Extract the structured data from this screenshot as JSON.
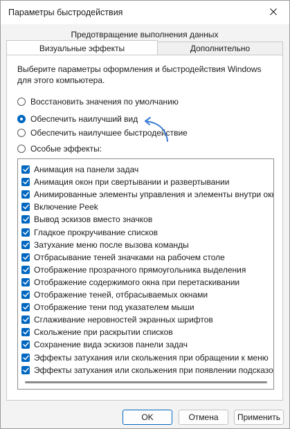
{
  "window": {
    "title": "Параметры быстродействия"
  },
  "tabs": {
    "top_row": "Предотвращение выполнения данных",
    "active": "Визуальные эффекты",
    "inactive": "Дополнительно"
  },
  "description": "Выберите параметры оформления и быстродействия Windows для этого компьютера.",
  "radios": [
    {
      "label": "Восстановить значения по умолчанию",
      "checked": false
    },
    {
      "label": "Обеспечить наилучший вид",
      "checked": true
    },
    {
      "label": "Обеспечить наилучшее быстродействие",
      "checked": false
    },
    {
      "label": "Особые эффекты:",
      "checked": false
    }
  ],
  "effects": [
    {
      "label": "Анимация на панели задач",
      "checked": true
    },
    {
      "label": "Анимация окон при свертывании и развертывании",
      "checked": true
    },
    {
      "label": "Анимированные элементы управления и элементы внутри окн",
      "checked": true
    },
    {
      "label": "Включение Peek",
      "checked": true
    },
    {
      "label": "Вывод эскизов вместо значков",
      "checked": true
    },
    {
      "label": "Гладкое прокручивание списков",
      "checked": true
    },
    {
      "label": "Затухание меню после вызова команды",
      "checked": true
    },
    {
      "label": "Отбрасывание теней значками на рабочем столе",
      "checked": true
    },
    {
      "label": "Отображение прозрачного прямоугольника выделения",
      "checked": true
    },
    {
      "label": "Отображение содержимого окна при перетаскивании",
      "checked": true
    },
    {
      "label": "Отображение теней, отбрасываемых окнами",
      "checked": true
    },
    {
      "label": "Отображение тени под указателем мыши",
      "checked": true
    },
    {
      "label": "Сглаживание неровностей экранных шрифтов",
      "checked": true
    },
    {
      "label": "Скольжение при раскрытии списков",
      "checked": true
    },
    {
      "label": "Сохранение вида эскизов панели задач",
      "checked": true
    },
    {
      "label": "Эффекты затухания или скольжения при обращении к меню",
      "checked": true
    },
    {
      "label": "Эффекты затухания или скольжения при появлении подсказок",
      "checked": true
    }
  ],
  "buttons": {
    "ok": "OK",
    "cancel": "Отмена",
    "apply": "Применить"
  },
  "colors": {
    "accent": "#0067c0",
    "panel": "#ffffff",
    "chrome": "#f3f3f3"
  },
  "icons": {
    "close": "close-icon",
    "checkbox": "checkmark-icon",
    "annotation": "curved-arrow-icon"
  }
}
